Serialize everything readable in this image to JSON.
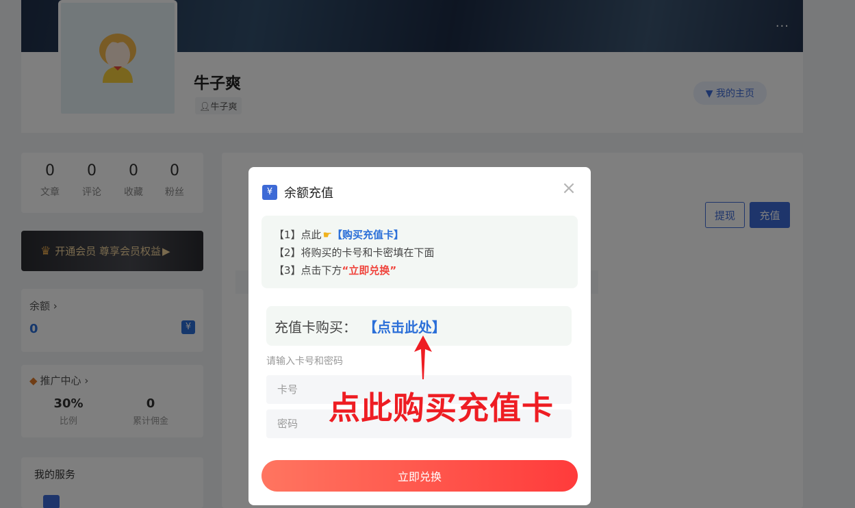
{
  "profile": {
    "username": "牛子爽",
    "user_tag": "牛子爽",
    "homepage_label": "我的主页",
    "more_label": "···"
  },
  "stats": [
    {
      "num": "0",
      "label": "文章"
    },
    {
      "num": "0",
      "label": "评论"
    },
    {
      "num": "0",
      "label": "收藏"
    },
    {
      "num": "0",
      "label": "粉丝"
    }
  ],
  "vip": {
    "label": "开通会员 尊享会员权益"
  },
  "balance": {
    "title": "余额",
    "value": "0"
  },
  "promo": {
    "title": "推广中心",
    "ratio_value": "30%",
    "ratio_label": "比例",
    "commission_value": "0",
    "commission_label": "累计佣金"
  },
  "services": {
    "title": "我的服务"
  },
  "main": {
    "withdraw_label": "提现",
    "recharge_label": "充值"
  },
  "modal": {
    "title": "余额充值",
    "close_glyph": "×",
    "step1_prefix": "【1】点此",
    "step1_link": "【购买充值卡】",
    "step2": "【2】将购买的卡号和卡密填在下面",
    "step3_prefix": "【3】点击下方",
    "step3_highlight": "“立即兑换”",
    "buy_label": "充值卡购买：",
    "buy_link": "【点击此处】",
    "input_hint": "请输入卡号和密码",
    "card_placeholder": "卡号",
    "password_placeholder": "密码",
    "submit_label": "立即兑换"
  },
  "annotation": {
    "text": "点此购买充值卡"
  },
  "colors": {
    "accent": "#3d6ad6",
    "link": "#2b6fd8",
    "danger": "#ee1d23"
  }
}
